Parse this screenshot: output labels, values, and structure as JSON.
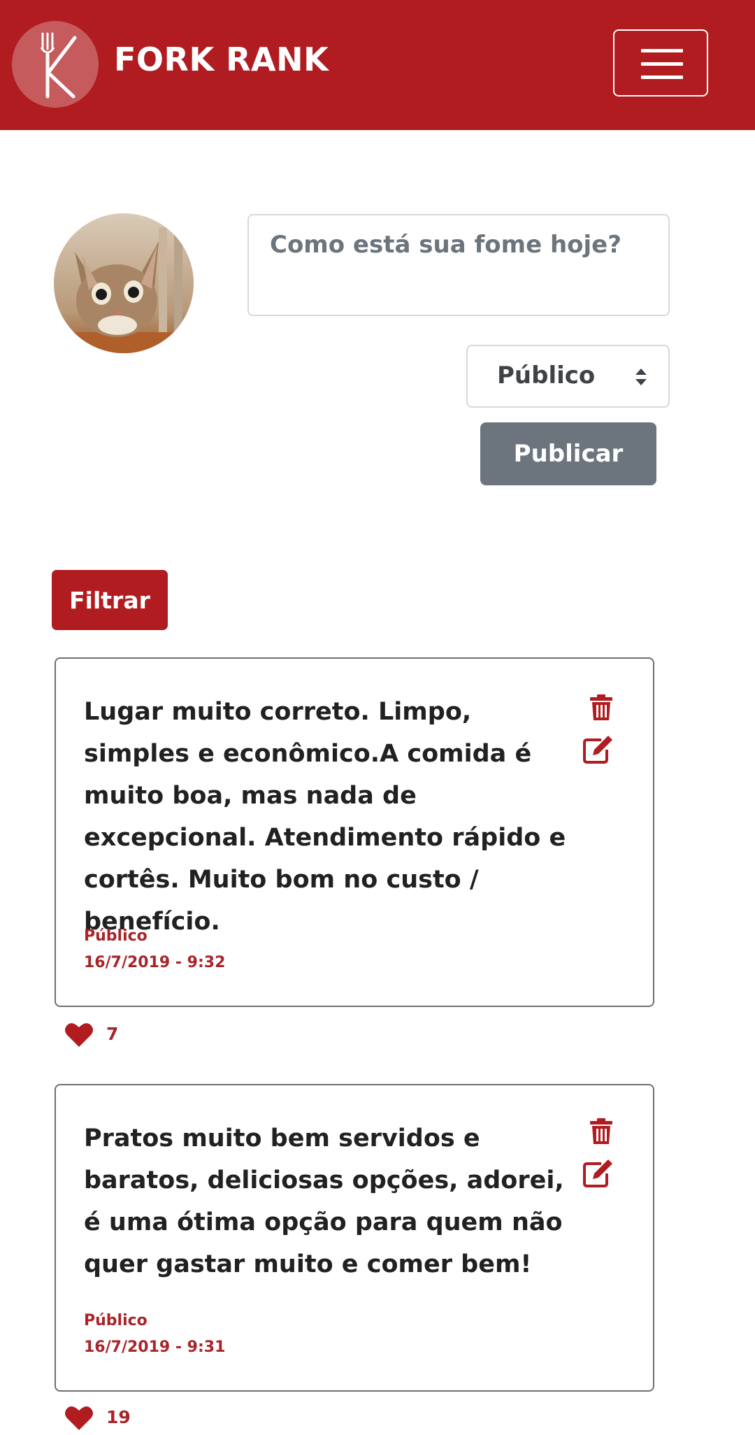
{
  "header": {
    "brand": "FORK RANK",
    "logo_icon": "fork-k-logo-icon",
    "menu_icon": "hamburger-menu-icon",
    "bg_color": "#b01c20"
  },
  "composer": {
    "avatar": "cat-avatar",
    "placeholder": "Como está sua fome hoje?",
    "privacy_selected": "Público",
    "publish_label": "Publicar"
  },
  "filter_label": "Filtrar",
  "posts": [
    {
      "text": "Lugar muito correto. Limpo, simples e econômico.A comida é muito boa, mas nada de excepcional. Atendimento rápido e cortês. Muito bom no custo / benefício.",
      "privacy": "Público",
      "date": "16/7/2019 - 9:32",
      "likes": "7"
    },
    {
      "text": "Pratos muito bem servidos e baratos, deliciosas opções, adorei, é uma ótima opção para quem não quer gastar muito e comer bem!",
      "privacy": "Público",
      "date": "16/7/2019 - 9:31",
      "likes": "19"
    }
  ],
  "colors": {
    "accent": "#b01c20",
    "muted_button": "#6c757d",
    "meta_text": "#a9242a"
  }
}
